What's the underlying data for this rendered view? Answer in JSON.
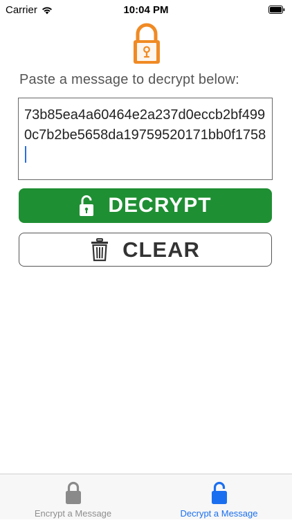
{
  "status_bar": {
    "carrier": "Carrier",
    "time": "10:04 PM"
  },
  "prompt": "Paste a message to decrypt below:",
  "message": {
    "value": "73b85ea4a60464e2a237d0eccb2bf4990c7b2be5658da19759520171bb0f1758"
  },
  "buttons": {
    "decrypt_label": "DECRYPT",
    "clear_label": "CLEAR"
  },
  "tab_bar": {
    "tabs": [
      {
        "label": "Encrypt a Message",
        "icon": "lock-closed-icon",
        "selected": false
      },
      {
        "label": "Decrypt a Message",
        "icon": "lock-open-icon",
        "selected": true
      }
    ]
  },
  "colors": {
    "accent_orange": "#f08a24",
    "decrypt_green": "#1f8f33",
    "tab_selected_blue": "#1a6ff0",
    "tab_unselected_gray": "#8e8e8e"
  }
}
